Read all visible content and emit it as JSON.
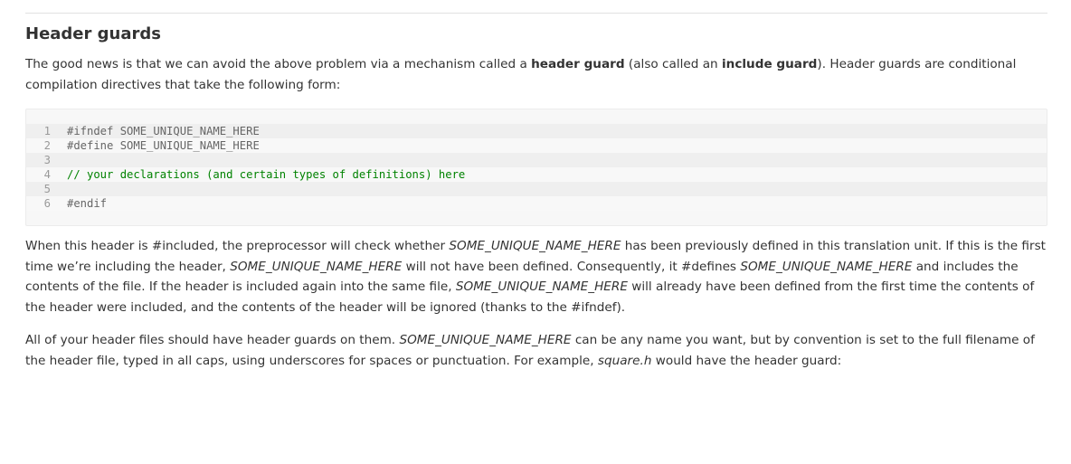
{
  "section": {
    "title": "Header guards"
  },
  "paragraph1": {
    "t1": "The good news is that we can avoid the above problem via a mechanism called a ",
    "b1": "header guard",
    "t2": " (also called an ",
    "b2": "include guard",
    "t3": "). Header guards are conditional compilation directives that take the following form:"
  },
  "code": {
    "lines": [
      {
        "num": "1",
        "text": "#ifndef SOME_UNIQUE_NAME_HERE",
        "kind": "pre"
      },
      {
        "num": "2",
        "text": "#define SOME_UNIQUE_NAME_HERE",
        "kind": "pre"
      },
      {
        "num": "3",
        "text": "",
        "kind": "plain"
      },
      {
        "num": "4",
        "text": "// your declarations (and certain types of definitions) here",
        "kind": "comment"
      },
      {
        "num": "5",
        "text": "",
        "kind": "plain"
      },
      {
        "num": "6",
        "text": "#endif",
        "kind": "pre"
      }
    ]
  },
  "paragraph2": {
    "t1": "When this header is #included, the preprocessor will check whether ",
    "i1": "SOME_UNIQUE_NAME_HERE",
    "t2": " has been previously defined in this translation unit. If this is the first time we’re including the header, ",
    "i2": "SOME_UNIQUE_NAME_HERE",
    "t3": " will not have been defined. Consequently, it #defines ",
    "i3": "SOME_UNIQUE_NAME_HERE",
    "t4": " and includes the contents of the file. If the header is included again into the same file, ",
    "i4": "SOME_UNIQUE_NAME_HERE",
    "t5": " will already have been defined from the first time the contents of the header were included, and the contents of the header will be ignored (thanks to the #ifndef)."
  },
  "paragraph3": {
    "t1": "All of your header files should have header guards on them. ",
    "i1": "SOME_UNIQUE_NAME_HERE",
    "t2": " can be any name you want, but by convention is set to the full filename of the header file, typed in all caps, using underscores for spaces or punctuation. For example, ",
    "i2": "square.h",
    "t3": " would have the header guard:"
  }
}
